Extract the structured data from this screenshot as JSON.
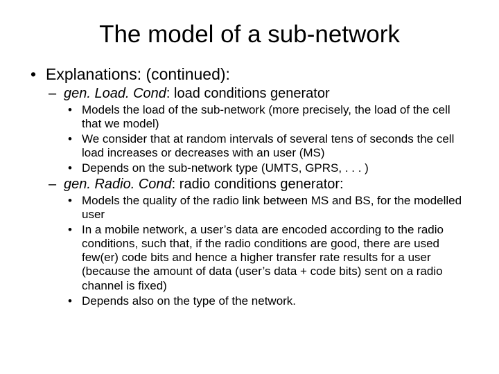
{
  "title": "The model of a sub-network",
  "l1_text": "Explanations: (continued):",
  "sec1": {
    "name": "gen. Load. Cond",
    "rest": ": load conditions generator",
    "b1": "Models the load of the sub-network (more precisely, the load of the cell that we model)",
    "b2": "We consider that at random intervals of several tens of seconds the cell load increases or decreases with an user (MS)",
    "b3": "Depends on the sub-network type (UMTS, GPRS, . . . )"
  },
  "sec2": {
    "name": "gen. Radio. Cond",
    "rest": ": radio conditions generator:",
    "b1": "Models the quality of the radio link between MS and BS, for the modelled user",
    "b2": "In a mobile network, a user’s data are encoded according to the radio conditions, such that, if the radio conditions are good, there are used few(er) code bits and hence a higher transfer rate results for a user (because the amount of data (user’s data + code bits) sent on a radio channel is fixed)",
    "b3": "Depends also on the type of the network."
  }
}
